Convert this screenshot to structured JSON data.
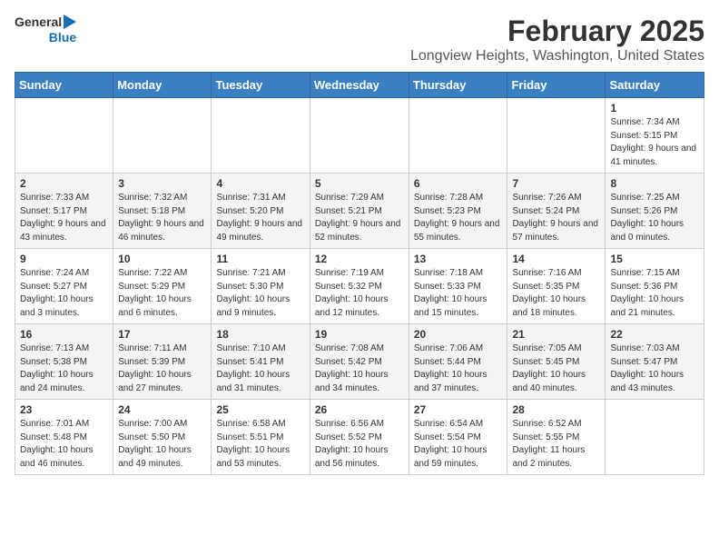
{
  "header": {
    "logo_line1": "General",
    "logo_line2": "Blue",
    "month_title": "February 2025",
    "location": "Longview Heights, Washington, United States"
  },
  "weekdays": [
    "Sunday",
    "Monday",
    "Tuesday",
    "Wednesday",
    "Thursday",
    "Friday",
    "Saturday"
  ],
  "weeks": [
    [
      {
        "num": "",
        "info": ""
      },
      {
        "num": "",
        "info": ""
      },
      {
        "num": "",
        "info": ""
      },
      {
        "num": "",
        "info": ""
      },
      {
        "num": "",
        "info": ""
      },
      {
        "num": "",
        "info": ""
      },
      {
        "num": "1",
        "info": "Sunrise: 7:34 AM\nSunset: 5:15 PM\nDaylight: 9 hours and 41 minutes."
      }
    ],
    [
      {
        "num": "2",
        "info": "Sunrise: 7:33 AM\nSunset: 5:17 PM\nDaylight: 9 hours and 43 minutes."
      },
      {
        "num": "3",
        "info": "Sunrise: 7:32 AM\nSunset: 5:18 PM\nDaylight: 9 hours and 46 minutes."
      },
      {
        "num": "4",
        "info": "Sunrise: 7:31 AM\nSunset: 5:20 PM\nDaylight: 9 hours and 49 minutes."
      },
      {
        "num": "5",
        "info": "Sunrise: 7:29 AM\nSunset: 5:21 PM\nDaylight: 9 hours and 52 minutes."
      },
      {
        "num": "6",
        "info": "Sunrise: 7:28 AM\nSunset: 5:23 PM\nDaylight: 9 hours and 55 minutes."
      },
      {
        "num": "7",
        "info": "Sunrise: 7:26 AM\nSunset: 5:24 PM\nDaylight: 9 hours and 57 minutes."
      },
      {
        "num": "8",
        "info": "Sunrise: 7:25 AM\nSunset: 5:26 PM\nDaylight: 10 hours and 0 minutes."
      }
    ],
    [
      {
        "num": "9",
        "info": "Sunrise: 7:24 AM\nSunset: 5:27 PM\nDaylight: 10 hours and 3 minutes."
      },
      {
        "num": "10",
        "info": "Sunrise: 7:22 AM\nSunset: 5:29 PM\nDaylight: 10 hours and 6 minutes."
      },
      {
        "num": "11",
        "info": "Sunrise: 7:21 AM\nSunset: 5:30 PM\nDaylight: 10 hours and 9 minutes."
      },
      {
        "num": "12",
        "info": "Sunrise: 7:19 AM\nSunset: 5:32 PM\nDaylight: 10 hours and 12 minutes."
      },
      {
        "num": "13",
        "info": "Sunrise: 7:18 AM\nSunset: 5:33 PM\nDaylight: 10 hours and 15 minutes."
      },
      {
        "num": "14",
        "info": "Sunrise: 7:16 AM\nSunset: 5:35 PM\nDaylight: 10 hours and 18 minutes."
      },
      {
        "num": "15",
        "info": "Sunrise: 7:15 AM\nSunset: 5:36 PM\nDaylight: 10 hours and 21 minutes."
      }
    ],
    [
      {
        "num": "16",
        "info": "Sunrise: 7:13 AM\nSunset: 5:38 PM\nDaylight: 10 hours and 24 minutes."
      },
      {
        "num": "17",
        "info": "Sunrise: 7:11 AM\nSunset: 5:39 PM\nDaylight: 10 hours and 27 minutes."
      },
      {
        "num": "18",
        "info": "Sunrise: 7:10 AM\nSunset: 5:41 PM\nDaylight: 10 hours and 31 minutes."
      },
      {
        "num": "19",
        "info": "Sunrise: 7:08 AM\nSunset: 5:42 PM\nDaylight: 10 hours and 34 minutes."
      },
      {
        "num": "20",
        "info": "Sunrise: 7:06 AM\nSunset: 5:44 PM\nDaylight: 10 hours and 37 minutes."
      },
      {
        "num": "21",
        "info": "Sunrise: 7:05 AM\nSunset: 5:45 PM\nDaylight: 10 hours and 40 minutes."
      },
      {
        "num": "22",
        "info": "Sunrise: 7:03 AM\nSunset: 5:47 PM\nDaylight: 10 hours and 43 minutes."
      }
    ],
    [
      {
        "num": "23",
        "info": "Sunrise: 7:01 AM\nSunset: 5:48 PM\nDaylight: 10 hours and 46 minutes."
      },
      {
        "num": "24",
        "info": "Sunrise: 7:00 AM\nSunset: 5:50 PM\nDaylight: 10 hours and 49 minutes."
      },
      {
        "num": "25",
        "info": "Sunrise: 6:58 AM\nSunset: 5:51 PM\nDaylight: 10 hours and 53 minutes."
      },
      {
        "num": "26",
        "info": "Sunrise: 6:56 AM\nSunset: 5:52 PM\nDaylight: 10 hours and 56 minutes."
      },
      {
        "num": "27",
        "info": "Sunrise: 6:54 AM\nSunset: 5:54 PM\nDaylight: 10 hours and 59 minutes."
      },
      {
        "num": "28",
        "info": "Sunrise: 6:52 AM\nSunset: 5:55 PM\nDaylight: 11 hours and 2 minutes."
      },
      {
        "num": "",
        "info": ""
      }
    ]
  ]
}
